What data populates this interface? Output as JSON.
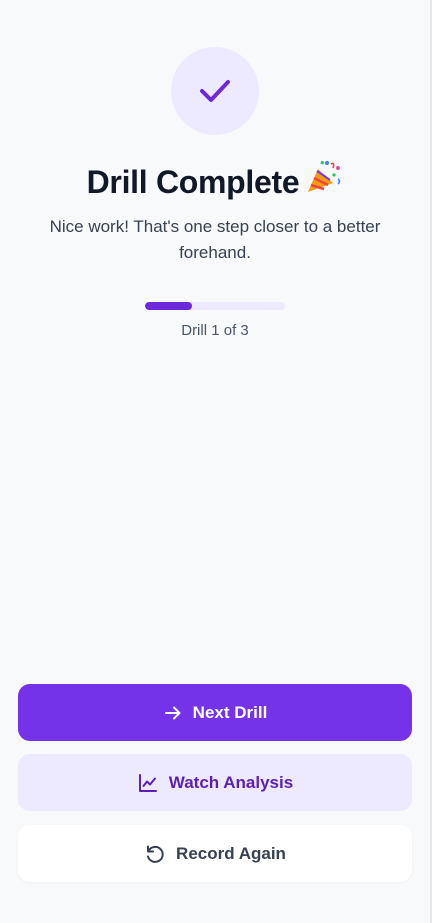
{
  "header": {
    "title": "Drill Complete",
    "subtitle": "Nice work! That's one step closer to a better forehand."
  },
  "progress": {
    "current": 1,
    "total": 3,
    "label": "Drill 1 of 3",
    "fraction": 0.333
  },
  "actions": {
    "next_label": "Next Drill",
    "watch_label": "Watch Analysis",
    "record_label": "Record Again"
  },
  "icons": {
    "status": "check-icon",
    "celebration": "party-popper-icon",
    "next": "arrow-right-icon",
    "watch": "chart-line-icon",
    "record": "rotate-ccw-icon"
  },
  "colors": {
    "accent": "#7432e9",
    "accent_light": "#ede9fe",
    "accent_dark": "#5b21b6",
    "background": "#f8f9fb",
    "text": "#111827"
  }
}
